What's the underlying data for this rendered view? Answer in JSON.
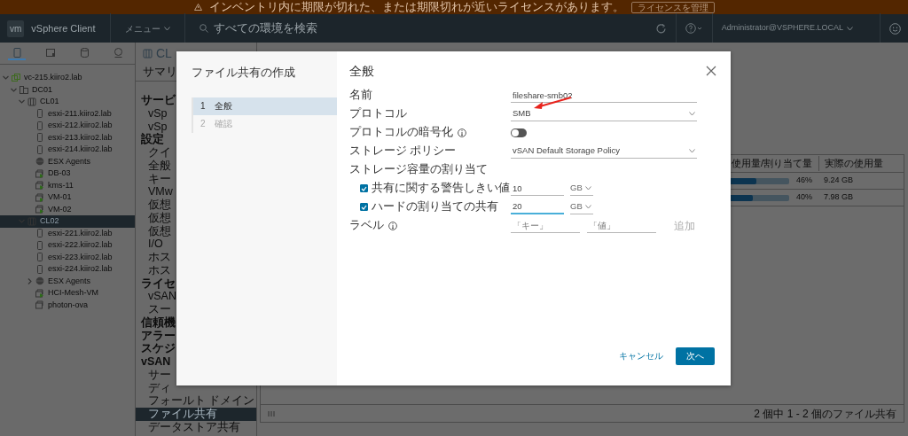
{
  "banner": {
    "message": "インベントリ内に期限が切れた、または期限切れが近いライセンスがあります。",
    "button": "ライセンスを管理"
  },
  "header": {
    "logo": "vm",
    "product": "vSphere Client",
    "menu": "メニュー",
    "search_placeholder": "すべての環境を検索",
    "user": "Administrator@VSPHERE.LOCAL"
  },
  "nav_tabs": [
    {
      "kind": "hosts",
      "selected": true
    },
    {
      "kind": "vms",
      "selected": false
    },
    {
      "kind": "storage",
      "selected": false
    },
    {
      "kind": "network",
      "selected": false
    }
  ],
  "tree": [
    {
      "label": "vc-215.kiiro2.lab",
      "kind": "vcenter",
      "expanded": true,
      "selected": false,
      "children": [
        {
          "label": "DC01",
          "kind": "datacenter",
          "expanded": true,
          "selected": false,
          "children": [
            {
              "label": "CL01",
              "kind": "cluster",
              "expanded": true,
              "selected": false,
              "children": [
                {
                  "label": "esxi-211.kiiro2.lab",
                  "kind": "host",
                  "selected": false
                },
                {
                  "label": "esxi-212.kiiro2.lab",
                  "kind": "host",
                  "selected": false
                },
                {
                  "label": "esxi-213.kiiro2.lab",
                  "kind": "host",
                  "selected": false
                },
                {
                  "label": "esxi-214.kiiro2.lab",
                  "kind": "host",
                  "selected": false
                },
                {
                  "label": "ESX Agents",
                  "kind": "pool",
                  "selected": false
                },
                {
                  "label": "DB-03",
                  "kind": "vm",
                  "selected": false
                },
                {
                  "label": "kms-11",
                  "kind": "vm",
                  "selected": false
                },
                {
                  "label": "VM-01",
                  "kind": "vm",
                  "selected": false
                },
                {
                  "label": "VM-02",
                  "kind": "vm",
                  "selected": false
                }
              ]
            },
            {
              "label": "CL02",
              "kind": "cluster",
              "expanded": true,
              "selected": true,
              "children": [
                {
                  "label": "esxi-221.kiiro2.lab",
                  "kind": "host",
                  "selected": false
                },
                {
                  "label": "esxi-222.kiiro2.lab",
                  "kind": "host",
                  "selected": false
                },
                {
                  "label": "esxi-223.kiiro2.lab",
                  "kind": "host",
                  "selected": false
                },
                {
                  "label": "esxi-224.kiiro2.lab",
                  "kind": "host",
                  "selected": false
                },
                {
                  "label": "ESX Agents",
                  "kind": "pool",
                  "expanded": false,
                  "selected": false
                },
                {
                  "label": "HCI-Mesh-VM",
                  "kind": "vm",
                  "selected": false
                },
                {
                  "label": "photon-ova",
                  "kind": "vm-off",
                  "selected": false
                }
              ]
            }
          ]
        }
      ]
    }
  ],
  "object": {
    "title": "CL",
    "tab": "サマリ"
  },
  "config_menu": [
    {
      "kind": "heading",
      "label": "サービ",
      "selected": false
    },
    {
      "kind": "item",
      "label": "vSp",
      "selected": false
    },
    {
      "kind": "item",
      "label": "vSp",
      "selected": false
    },
    {
      "kind": "heading",
      "label": "設定",
      "selected": false
    },
    {
      "kind": "item",
      "label": "クイ",
      "selected": false
    },
    {
      "kind": "item",
      "label": "全般",
      "selected": false
    },
    {
      "kind": "item",
      "label": "キー",
      "selected": false
    },
    {
      "kind": "item",
      "label": "VMw",
      "selected": false
    },
    {
      "kind": "item",
      "label": "仮想",
      "selected": false
    },
    {
      "kind": "item",
      "label": "仮想",
      "selected": false
    },
    {
      "kind": "item",
      "label": "仮想",
      "selected": false
    },
    {
      "kind": "item",
      "label": "I/O",
      "selected": false
    },
    {
      "kind": "item",
      "label": "ホス",
      "selected": false
    },
    {
      "kind": "item",
      "label": "ホス",
      "selected": false
    },
    {
      "kind": "heading",
      "label": "ライセ",
      "selected": false
    },
    {
      "kind": "item",
      "label": "vSAN",
      "selected": false
    },
    {
      "kind": "item",
      "label": "スー",
      "selected": false
    },
    {
      "kind": "heading",
      "label": "信頼機",
      "selected": false
    },
    {
      "kind": "heading",
      "label": "アラー",
      "selected": false
    },
    {
      "kind": "heading",
      "label": "スケジ",
      "selected": false
    },
    {
      "kind": "heading",
      "label": "vSAN",
      "selected": false
    },
    {
      "kind": "item",
      "label": "サー",
      "selected": false
    },
    {
      "kind": "item",
      "label": "ディ",
      "selected": false
    },
    {
      "kind": "item",
      "label": "フォールト ドメイン",
      "selected": false
    },
    {
      "kind": "item",
      "label": "ファイル共有",
      "selected": true
    },
    {
      "kind": "item",
      "label": "データストア共有",
      "selected": false
    }
  ],
  "file_shares_table": {
    "columns": [
      "使用量/割り当て量",
      "実際の使用量"
    ],
    "rows": [
      {
        "level": 0.46,
        "percent": "46%",
        "actual": "9.24 GB"
      },
      {
        "level": 0.4,
        "percent": "40%",
        "actual": "7.98 GB"
      }
    ],
    "footer": "2 個中 1 - 2 個のファイル共有"
  },
  "dialog": {
    "title": "ファイル共有の作成",
    "steps": [
      {
        "number": "1",
        "label": "全般",
        "selected": true
      },
      {
        "number": "2",
        "label": "確認",
        "selected": false
      }
    ],
    "heading": "全般",
    "fields": [
      {
        "kind": "text",
        "label": "名前",
        "value": "fileshare-smb02"
      },
      {
        "kind": "select",
        "label": "プロトコル",
        "value": "SMB",
        "arrow": true
      },
      {
        "kind": "toggle",
        "label": "プロトコルの暗号化",
        "info": true,
        "on": false
      },
      {
        "kind": "select",
        "label": "ストレージ ポリシー",
        "value": "vSAN Default Storage Policy"
      },
      {
        "kind": "section",
        "label": "ストレージ容量の割り当て"
      },
      {
        "kind": "quota",
        "label": "共有に関する警告しきい値",
        "checked": true,
        "value": "10",
        "unit": "GB",
        "focused": false
      },
      {
        "kind": "quota",
        "label": "ハードの割り当ての共有",
        "checked": true,
        "value": "20",
        "unit": "GB",
        "focused": true
      },
      {
        "kind": "labels",
        "label": "ラベル",
        "info": true,
        "key_placeholder": "「キー」",
        "value_placeholder": "「値」",
        "add": "追加",
        "add_disabled": true
      }
    ],
    "cancel": "キャンセル",
    "next": "次へ"
  }
}
